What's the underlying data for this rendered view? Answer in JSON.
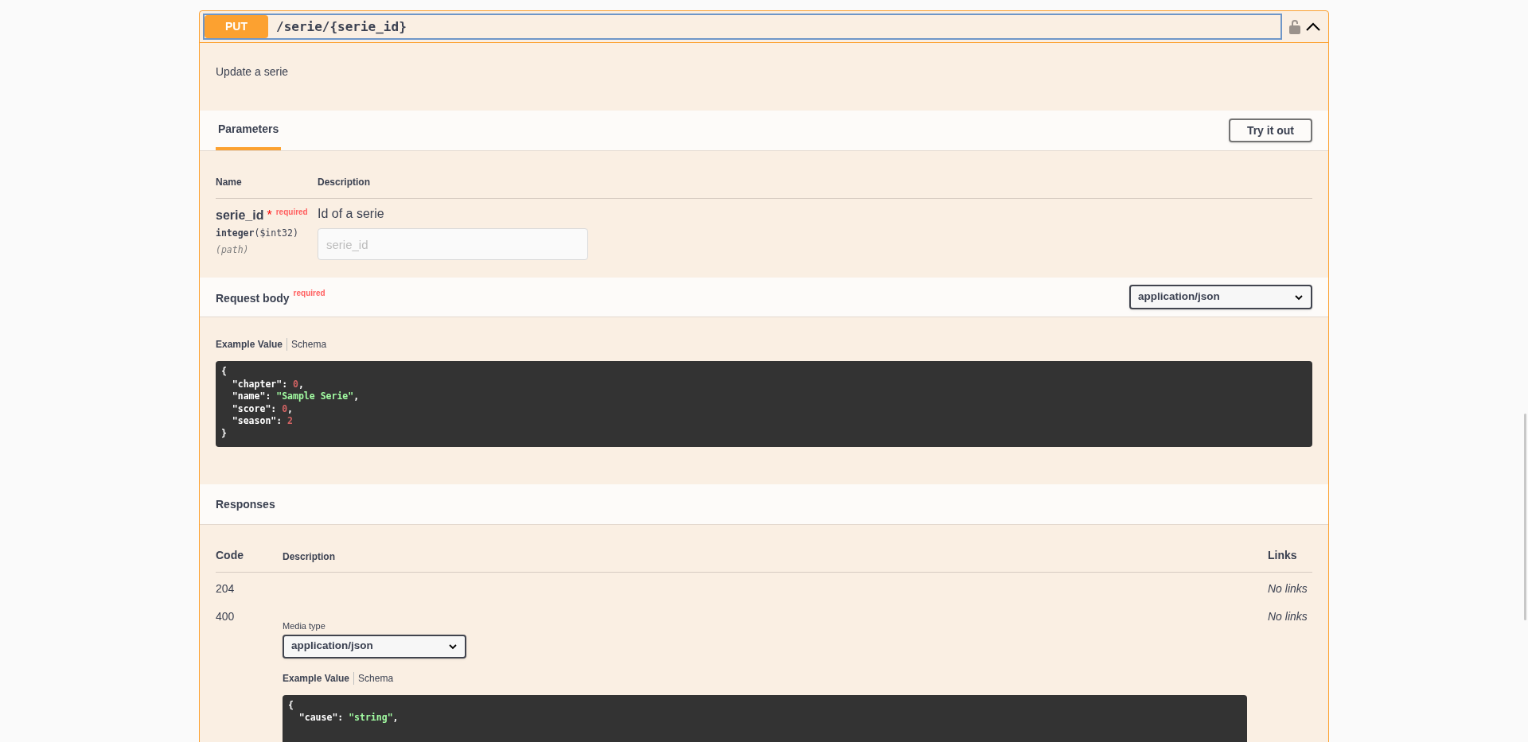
{
  "operation": {
    "method": "PUT",
    "path": "/serie/{serie_id}",
    "expanded": true,
    "locked": false,
    "summary": "Update a serie"
  },
  "parameters": {
    "tabs": [
      {
        "label": "Parameters",
        "selected": true
      }
    ],
    "try_button": "Try it out",
    "columns": [
      "Name",
      "Description"
    ],
    "rows": [
      {
        "name": "serie_id",
        "required_mark": "*",
        "required_label": "required",
        "type": "integer",
        "format": "($int32)",
        "location": "(path)",
        "description": "Id of a serie",
        "placeholder": "serie_id"
      }
    ]
  },
  "request_body": {
    "title": "Request body",
    "required_label": "required",
    "media_type": "application/json",
    "example_tabs": [
      {
        "label": "Example Value",
        "selected": true
      },
      {
        "label": "Schema",
        "selected": false
      }
    ],
    "code": [
      [
        {
          "kind": "plain",
          "text": "{"
        }
      ],
      [
        {
          "kind": "plain",
          "text": "  \"chapter\": "
        },
        {
          "kind": "number",
          "text": "0"
        },
        {
          "kind": "plain",
          "text": ","
        }
      ],
      [
        {
          "kind": "plain",
          "text": "  \"name\": "
        },
        {
          "kind": "string",
          "text": "\"Sample Serie\""
        },
        {
          "kind": "plain",
          "text": ","
        }
      ],
      [
        {
          "kind": "plain",
          "text": "  \"score\": "
        },
        {
          "kind": "number",
          "text": "0"
        },
        {
          "kind": "plain",
          "text": ","
        }
      ],
      [
        {
          "kind": "plain",
          "text": "  \"season\": "
        },
        {
          "kind": "number",
          "text": "2"
        }
      ],
      [
        {
          "kind": "plain",
          "text": "}"
        }
      ]
    ]
  },
  "responses": {
    "title": "Responses",
    "columns": [
      "Code",
      "Description",
      "Links"
    ],
    "rows": [
      {
        "code": "204",
        "links": "No links"
      },
      {
        "code": "400",
        "links": "No links",
        "media_label": "Media type",
        "media_type": "application/json",
        "example_tabs": [
          {
            "label": "Example Value",
            "selected": true
          },
          {
            "label": "Schema",
            "selected": false
          }
        ],
        "code_lines": [
          [
            {
              "kind": "plain",
              "text": "{"
            }
          ],
          [
            {
              "kind": "plain",
              "text": "  \"cause\": "
            },
            {
              "kind": "string",
              "text": "\"string\""
            },
            {
              "kind": "plain",
              "text": ","
            }
          ]
        ]
      }
    ]
  }
}
